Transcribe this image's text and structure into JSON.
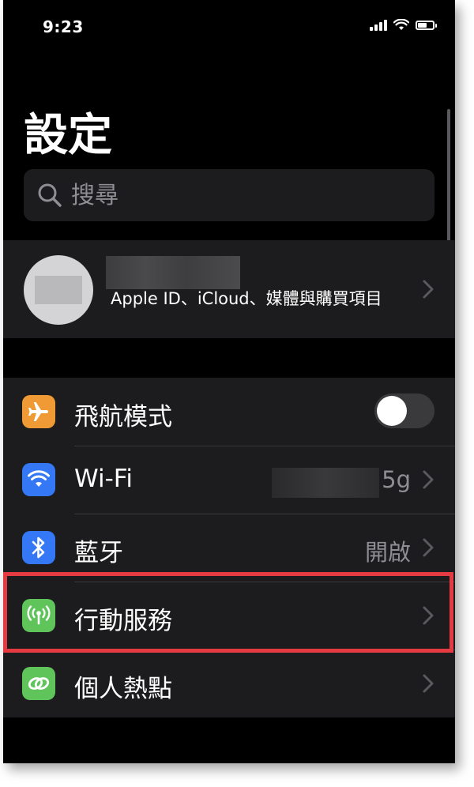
{
  "status_bar": {
    "time": "9:23"
  },
  "title": "設定",
  "search": {
    "placeholder": "搜尋"
  },
  "profile": {
    "subtitle": "Apple ID、iCloud、媒體與購買項目"
  },
  "rows": [
    {
      "label": "飛航模式",
      "icon": "airplane-icon",
      "icon_color": "#f09a36",
      "control": "toggle",
      "toggle_on": false
    },
    {
      "label": "Wi-Fi",
      "icon": "wifi-icon",
      "icon_color": "#3478f6",
      "value_suffix": "5g"
    },
    {
      "label": "藍牙",
      "icon": "bluetooth-icon",
      "icon_color": "#3478f6",
      "value": "開啟"
    },
    {
      "label": "行動服務",
      "icon": "cellular-antenna-icon",
      "icon_color": "#5fc45a",
      "highlighted": true
    },
    {
      "label": "個人熱點",
      "icon": "hotspot-link-icon",
      "icon_color": "#5fc45a"
    }
  ],
  "colors": {
    "background": "#000000",
    "group_bg": "#1c1c1e",
    "secondary_text": "#8e8e93",
    "highlight": "#e43b42"
  }
}
